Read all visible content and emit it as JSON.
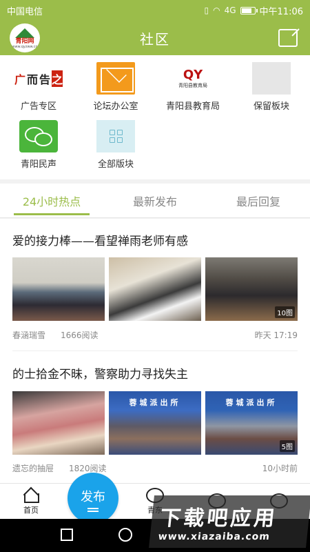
{
  "status_bar": {
    "carrier": "中国电信",
    "time": "中午11:06",
    "signal": "4G",
    "battery_level": 0.85
  },
  "header": {
    "logo_text": "青阳网",
    "logo_sub": "www.qyzww.cn",
    "title": "社区"
  },
  "sections": [
    {
      "label": "广告专区",
      "icon": "ad-icon",
      "glyphs": [
        "广",
        "而",
        "告",
        "之"
      ]
    },
    {
      "label": "论坛办公室",
      "icon": "mail-icon"
    },
    {
      "label": "青阳县教育局",
      "icon": "education-logo-icon",
      "logo_text": "QY",
      "logo_sub": "青阳县教育局"
    },
    {
      "label": "保留板块",
      "icon": "placeholder-icon"
    },
    {
      "label": "青阳民声",
      "icon": "wechat-icon"
    },
    {
      "label": "全部版块",
      "icon": "grid-icon"
    }
  ],
  "tabs": [
    {
      "label": "24小时热点",
      "active": true
    },
    {
      "label": "最新发布",
      "active": false
    },
    {
      "label": "最后回复",
      "active": false
    }
  ],
  "posts": [
    {
      "title": "爱的接力棒——看望禅雨老师有感",
      "author": "春涵瑞雪",
      "views": "1666阅读",
      "time": "昨天 17:19",
      "photo_count": "10图"
    },
    {
      "title": "的士拾金不昧，警察助力寻找失主",
      "author": "遗忘的抽屉",
      "views": "1820阅读",
      "time": "10小时前",
      "photo_count": "5图",
      "photo_banner": "蓉城派出所"
    }
  ],
  "bottom_nav": {
    "items": [
      {
        "label": "首页",
        "icon": "home-icon"
      },
      {
        "label": "青东",
        "icon": "camera-icon"
      },
      {
        "label": "",
        "icon": "chat-icon"
      },
      {
        "label": "",
        "icon": "rocket-icon"
      }
    ],
    "fab_label": "发布"
  },
  "watermark": {
    "title": "下载吧应用",
    "url": "www.xiazaiba.com"
  },
  "colors": {
    "brand_green": "#9bbd4a",
    "fab_blue": "#1aa3ea"
  }
}
